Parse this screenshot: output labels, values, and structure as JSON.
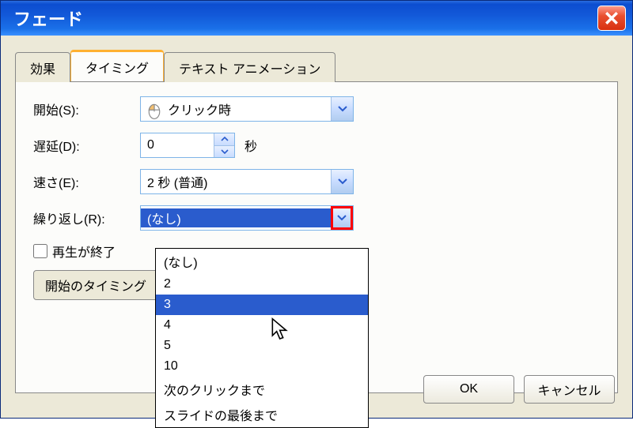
{
  "title": "フェード",
  "tabs": {
    "effect": "効果",
    "timing": "タイミング",
    "textanim": "テキスト アニメーション"
  },
  "labels": {
    "start": "開始(S):",
    "delay": "遅延(D):",
    "speed": "速さ(E):",
    "repeat": "繰り返し(R):",
    "seconds": "秒",
    "rewind_checkbox": "再生が終了",
    "trigger_button": "開始のタイミング"
  },
  "values": {
    "start": "クリック時",
    "delay": "0",
    "speed": "2 秒 (普通)",
    "repeat": "(なし)"
  },
  "repeat_options": {
    "opt0": "(なし)",
    "opt1": "2",
    "opt2": "3",
    "opt3": "4",
    "opt4": "5",
    "opt5": "10",
    "opt6": "次のクリックまで",
    "opt7": "スライドの最後まで"
  },
  "buttons": {
    "ok": "OK",
    "cancel": "キャンセル"
  }
}
